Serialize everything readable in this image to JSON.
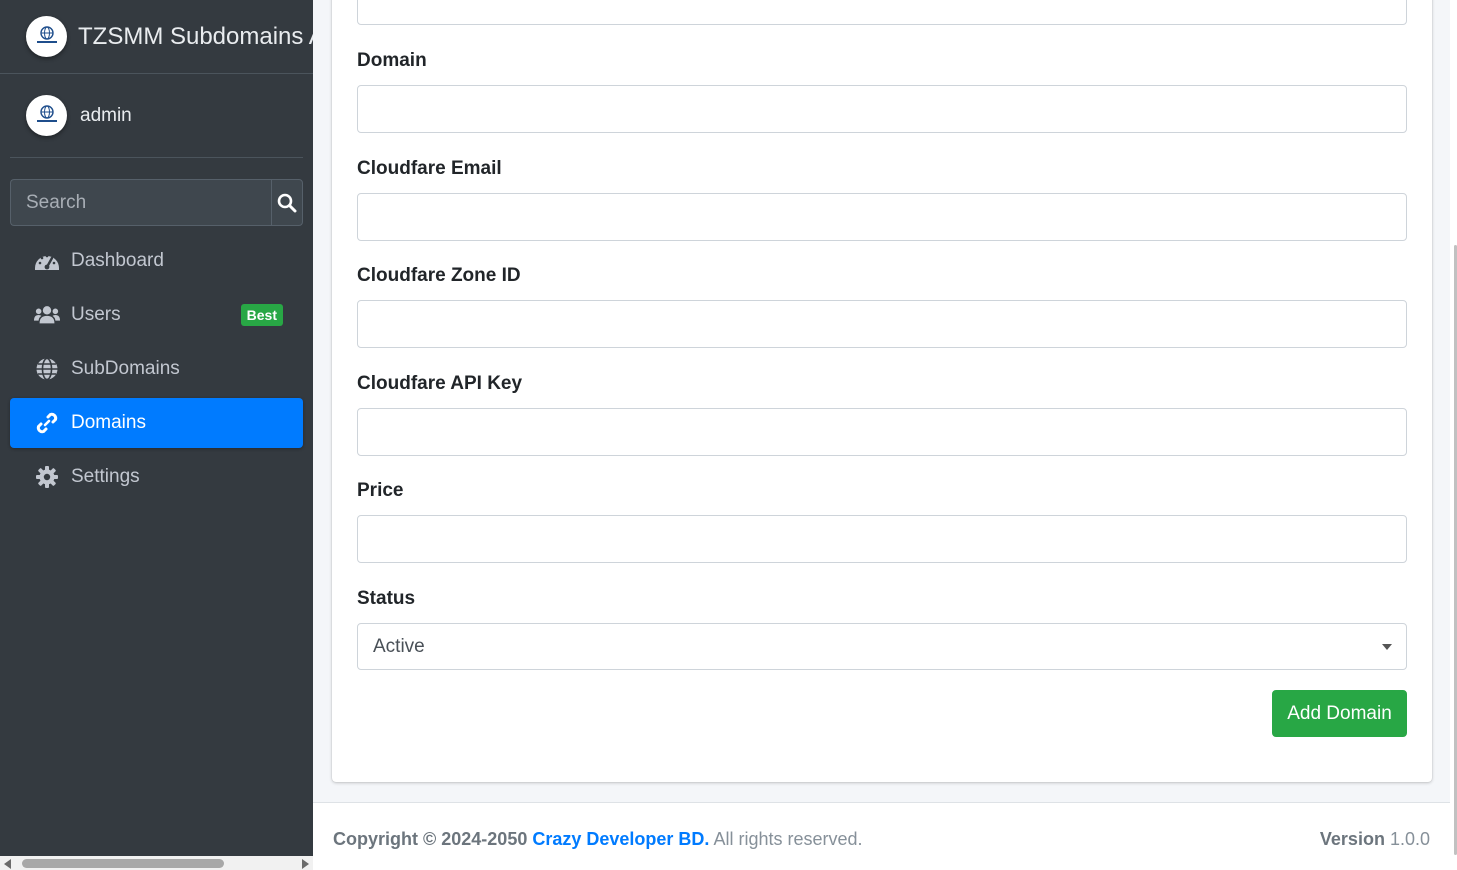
{
  "brand": {
    "title": "TZSMM Subdomains Admin"
  },
  "user": {
    "name": "admin"
  },
  "search": {
    "placeholder": "Search"
  },
  "nav": [
    {
      "label": "Dashboard",
      "icon": "tachometer-icon"
    },
    {
      "label": "Users",
      "icon": "users-icon",
      "badge": "Best"
    },
    {
      "label": "SubDomains",
      "icon": "globe-icon"
    },
    {
      "label": "Domains",
      "icon": "link-icon",
      "active": true
    },
    {
      "label": "Settings",
      "icon": "gear-icon"
    }
  ],
  "form": {
    "domain_label": "Domain",
    "domain_value": "",
    "email_label": "Cloudfare Email",
    "email_value": "",
    "zone_label": "Cloudfare Zone ID",
    "zone_value": "",
    "api_label": "Cloudfare API Key",
    "api_value": "",
    "price_label": "Price",
    "price_value": "",
    "status_label": "Status",
    "status_value": "Active",
    "submit_label": "Add Domain"
  },
  "footer": {
    "copyright_prefix": "Copyright © 2024-2050",
    "company": "Crazy Developer BD.",
    "suffix": "All rights reserved.",
    "version_label": "Version",
    "version_value": "1.0.0"
  },
  "colors": {
    "sidebar_bg": "#343a40",
    "active": "#007bff",
    "success": "#28a745"
  }
}
